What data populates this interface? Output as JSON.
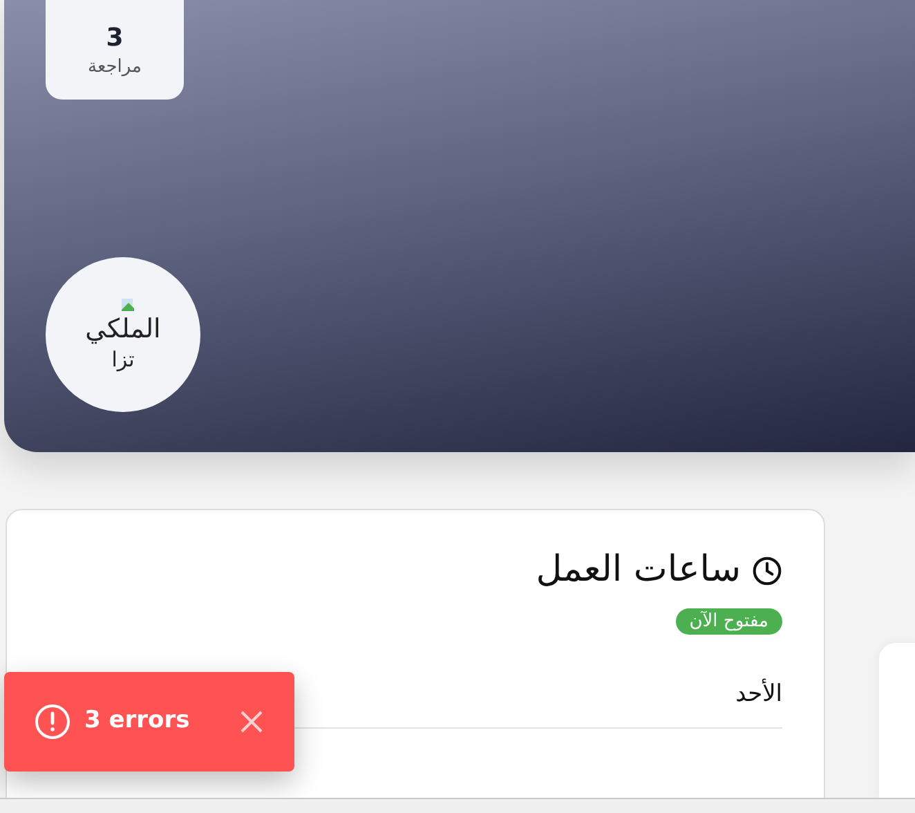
{
  "hero": {
    "stat": {
      "value": "3",
      "label": "مراجعة"
    },
    "logo": {
      "lines": [
        "الملكي",
        "تزا"
      ]
    }
  },
  "hours_card": {
    "title": "ساعات العمل",
    "status": {
      "text": "مفتوح الآن",
      "open": true
    },
    "days": [
      {
        "day": "الأحد"
      }
    ]
  },
  "toast": {
    "text": "3 errors"
  }
}
